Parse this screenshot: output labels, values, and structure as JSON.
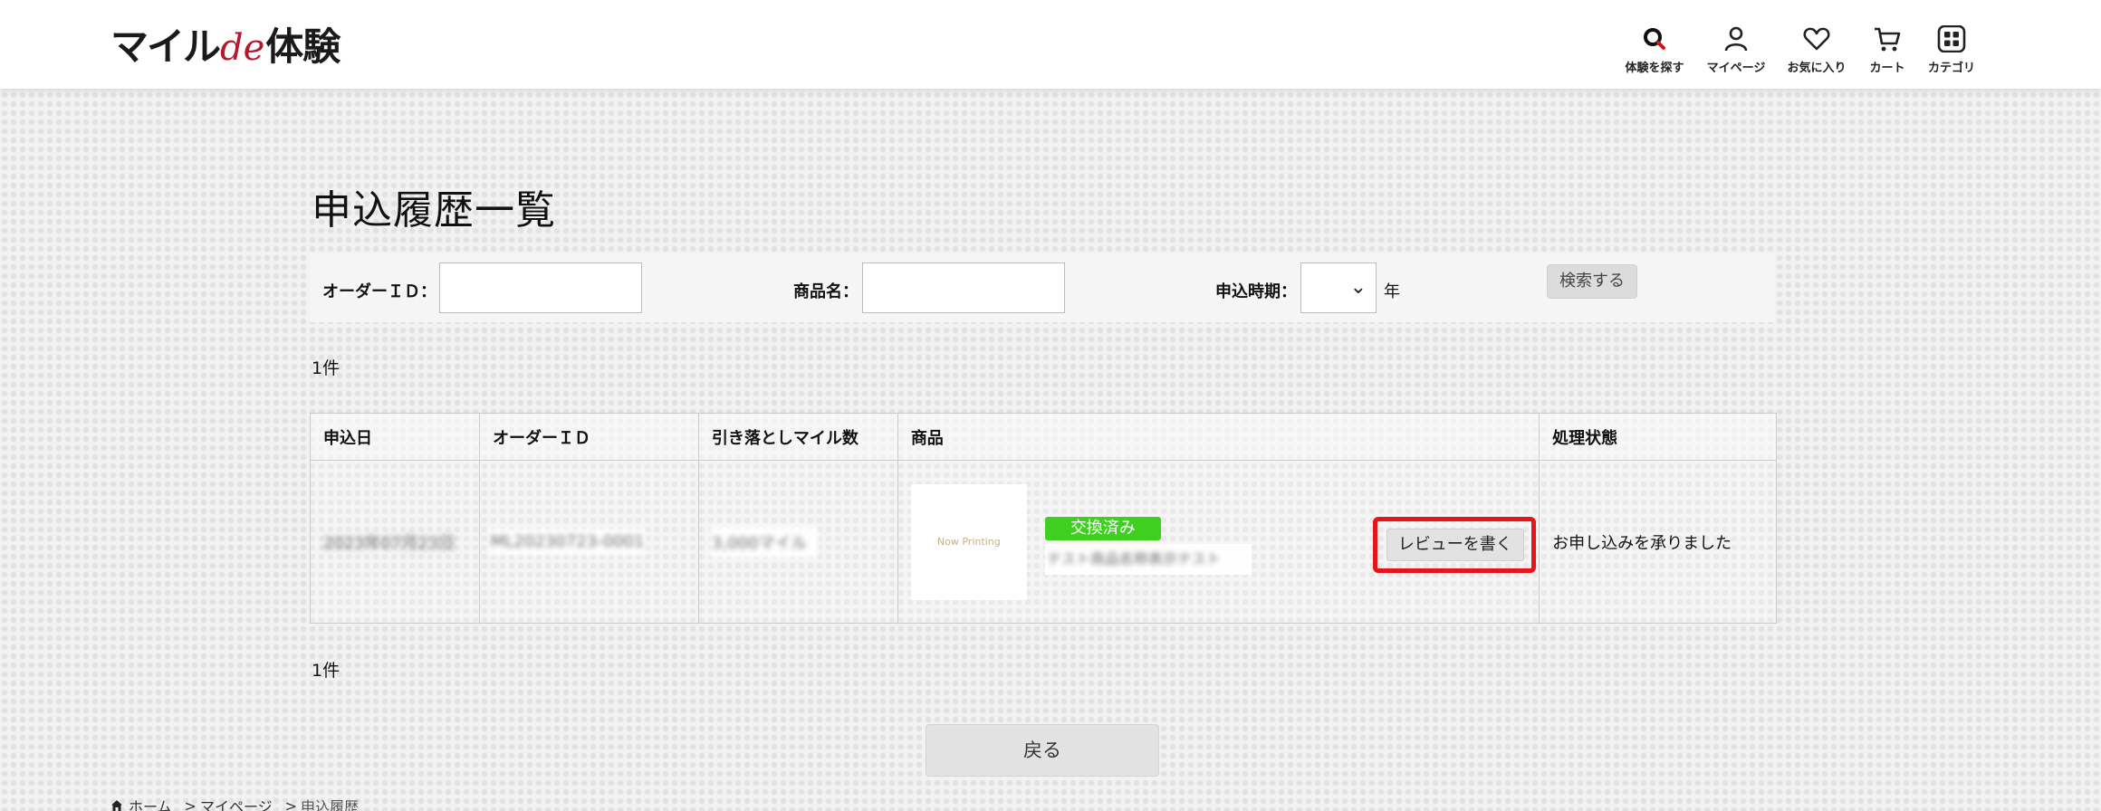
{
  "header": {
    "logo": {
      "part1": "マイル",
      "part2": "de",
      "part3": "体験"
    },
    "nav": [
      {
        "label": "体験を探す",
        "icon": "search-icon"
      },
      {
        "label": "マイページ",
        "icon": "user-icon"
      },
      {
        "label": "お気に入り",
        "icon": "heart-icon"
      },
      {
        "label": "カート",
        "icon": "cart-icon"
      },
      {
        "label": "カテゴリ",
        "icon": "grid-icon"
      }
    ]
  },
  "page": {
    "title": "申込履歴一覧"
  },
  "search": {
    "order_id_label": "オーダーＩＤ：",
    "order_id_value": "",
    "product_label": "商品名：",
    "product_value": "",
    "period_label": "申込時期：",
    "period_value": "",
    "year_label": "年",
    "button_label": "検索する"
  },
  "result_count_top": "1件",
  "result_count_bottom": "1件",
  "table": {
    "headers": [
      "申込日",
      "オーダーＩＤ",
      "引き落としマイル数",
      "商品",
      "処理状態"
    ],
    "rows": [
      {
        "date": "2023年07月23日",
        "order_id": "ML20230723-0001",
        "miles": "3,000マイル",
        "product": {
          "image_text": "Now Printing",
          "badge": "交換済み",
          "name": "テスト商品名称表示テスト",
          "review_button": "レビューを書く"
        },
        "status": "お申し込みを承りました"
      }
    ]
  },
  "back_button": "戻る",
  "breadcrumb": [
    "ホーム",
    "マイページ",
    "申込履歴"
  ],
  "colors": {
    "brand_red": "#b5172b",
    "highlight_red": "#e8141b",
    "badge_green": "#3ecf20"
  }
}
